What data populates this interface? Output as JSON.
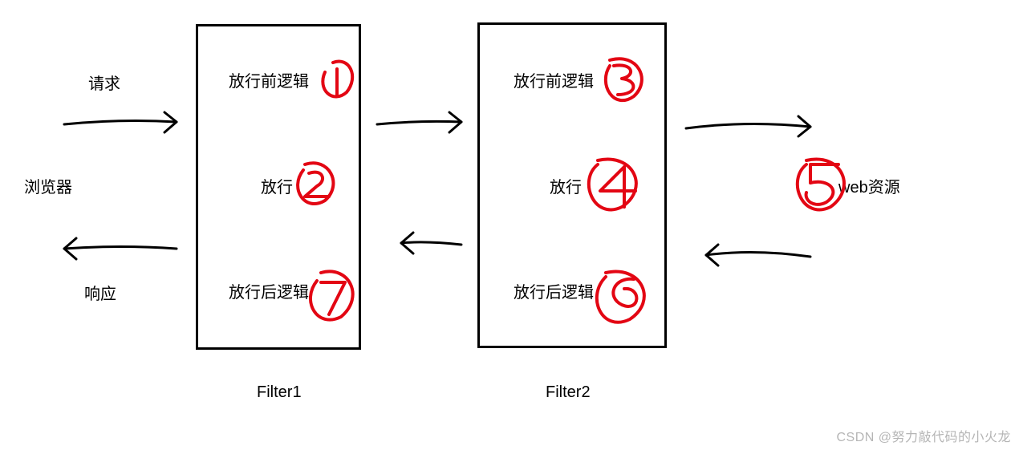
{
  "left": {
    "request": "请求",
    "browser": "浏览器",
    "response": "响应"
  },
  "filter1": {
    "pre": "放行前逻辑",
    "pass": "放行",
    "post": "放行后逻辑",
    "caption": "Filter1"
  },
  "filter2": {
    "pre": "放行前逻辑",
    "pass": "放行",
    "post": "放行后逻辑",
    "caption": "Filter2"
  },
  "right": {
    "web_resource": "web资源"
  },
  "annotations": {
    "n1": "1",
    "n2": "2",
    "n3": "3",
    "n4": "4",
    "n5": "5",
    "n6": "6",
    "n7": "7"
  },
  "watermark": "CSDN @努力敲代码的小火龙"
}
